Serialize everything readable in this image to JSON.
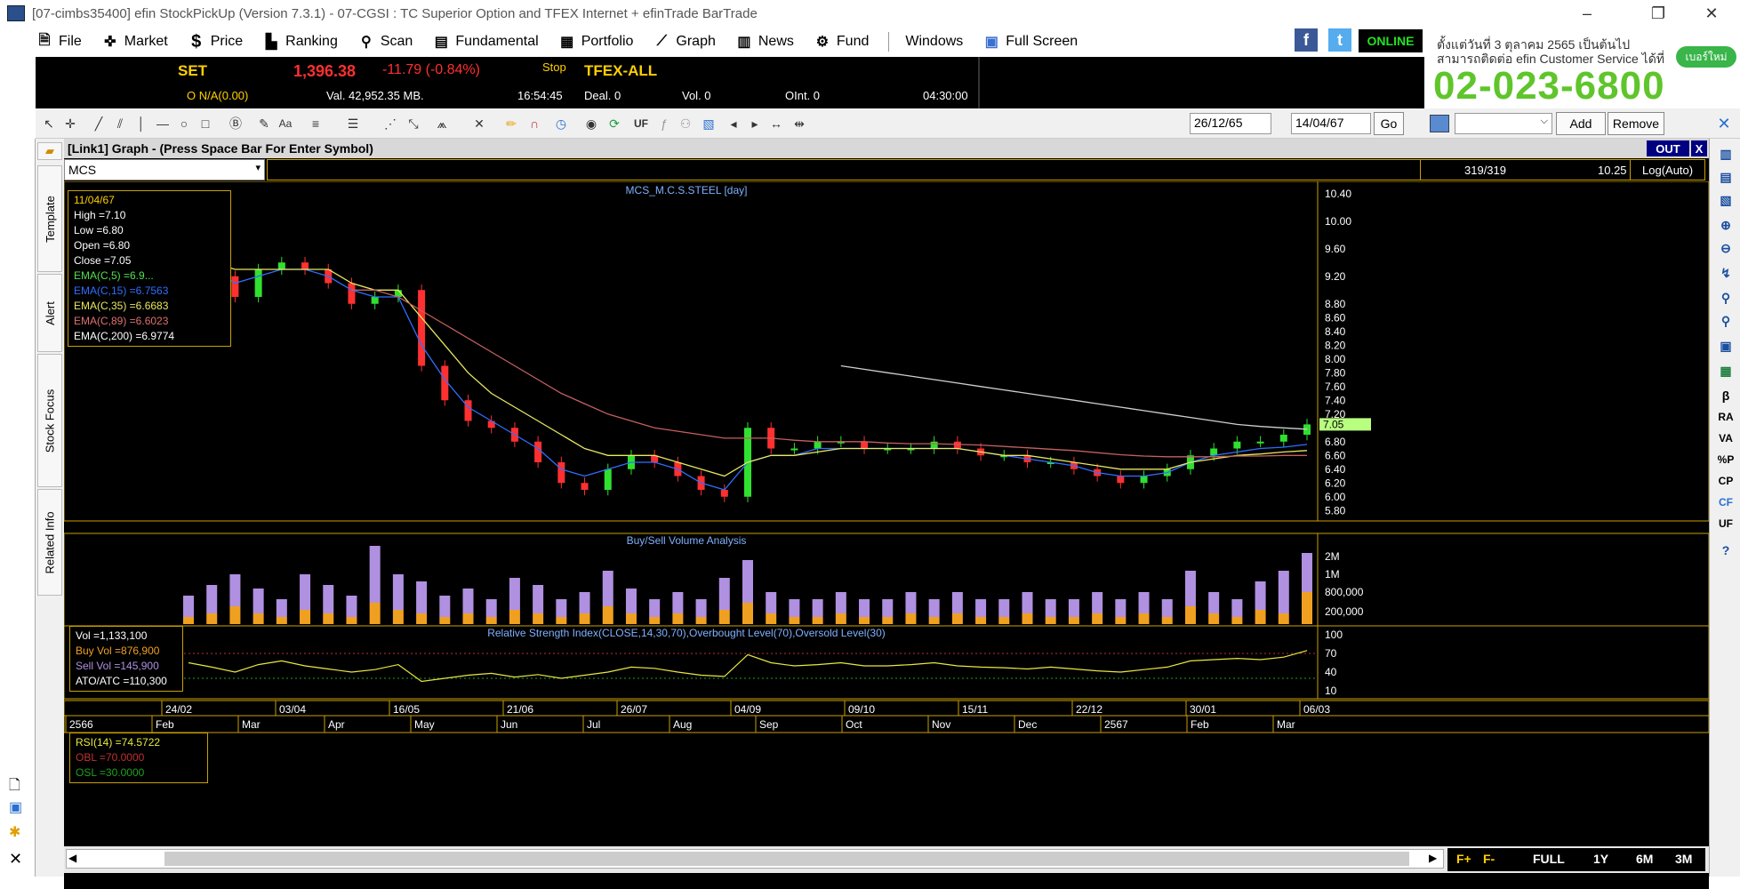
{
  "window": {
    "title": "[07-cimbs35400] efin StockPickUp (Version 7.3.1) - 07-CGSI : TC Superior Option and TFEX Internet + efinTrade BarTrade",
    "minimize": "–",
    "restore": "❐",
    "close": "✕"
  },
  "menu": [
    {
      "label": "File",
      "icon": "document-icon"
    },
    {
      "label": "Market",
      "icon": "market-icon"
    },
    {
      "label": "Price",
      "icon": "dollar-icon"
    },
    {
      "label": "Ranking",
      "icon": "ranking-icon"
    },
    {
      "label": "Scan",
      "icon": "scan-icon"
    },
    {
      "label": "Fundamental",
      "icon": "fundamental-icon"
    },
    {
      "label": "Portfolio",
      "icon": "portfolio-icon"
    },
    {
      "label": "Graph",
      "icon": "graph-icon"
    },
    {
      "label": "News",
      "icon": "news-icon"
    },
    {
      "label": "Fund",
      "icon": "fund-icon"
    },
    {
      "label": "Windows",
      "icon": ""
    },
    {
      "label": "Full Screen",
      "icon": "fullscreen-icon"
    }
  ],
  "status": {
    "online": "ONLINE"
  },
  "ad": {
    "line1": "ตั้งแต่วันที่ 3 ตุลาคม 2565 เป็นต้นไป",
    "line2": "สามารถติดต่อ efin Customer Service ได้ที่",
    "phone": "02-023-6800",
    "badge": "เบอร์ใหม่"
  },
  "ticker": {
    "set_label": "SET",
    "set_value": "1,396.38",
    "set_change": "-11.79 (-0.84%)",
    "set_sub": "O N/A(0.00)",
    "stop": "Stop",
    "value": "Val. 42,952.35 MB.",
    "time": "16:54:45",
    "tfex_label": "TFEX-ALL",
    "deal": "Deal. 0",
    "vol": "Vol. 0",
    "oint": "OInt. 0",
    "tfex_time": "04:30:00"
  },
  "toolbar": {
    "date_from": "26/12/65",
    "date_to": "14/04/67",
    "go": "Go",
    "add": "Add",
    "remove": "Remove",
    "uf": "UF",
    "aa": "Aa"
  },
  "graph": {
    "window_title": "[Link1] Graph  - (Press Space Bar For Enter Symbol)",
    "out": "OUT",
    "close": "X",
    "symbol": "MCS",
    "counter": "319/319",
    "last": "10.25",
    "scale": "Log(Auto)"
  },
  "side_tabs": [
    "Template",
    "Alert",
    "Stock Focus",
    "Related Info"
  ],
  "right_tools": [
    "β",
    "RA",
    "VA",
    "%P",
    "CP",
    "CF",
    "UF"
  ],
  "price_info": {
    "date": "11/04/67",
    "high": "High  =7.10",
    "low": "Low   =6.80",
    "open": "Open  =6.80",
    "close": "Close =7.05",
    "ema5": "EMA(C,5)   =6.9...",
    "ema15": "EMA(C,15)   =6.7563",
    "ema35": "EMA(C,35)   =6.6683",
    "ema89": "EMA(C,89)   =6.6023",
    "ema200": "EMA(C,200)  =6.9774"
  },
  "vol_info": {
    "vol": "Vol   =1,133,100",
    "buy": "Buy Vol   =876,900",
    "sell": "Sell Vol   =145,900",
    "ato": "ATO/ATC   =110,300"
  },
  "rsi_info": {
    "rsi": "RSI(14)   =74.5722",
    "obl": "OBL   =70.0000",
    "osl": "OSL   =30.0000"
  },
  "bottom_nav": {
    "f_plus": "F+",
    "f_minus": "F-",
    "full": "FULL",
    "y1": "1Y",
    "m6": "6M",
    "m3": "3M"
  },
  "chart_data": [
    {
      "type": "line",
      "title": "MCS_M.C.S.STEEL [day]",
      "ylim": [
        5.7,
        10.5
      ],
      "y_ticks": [
        "10.40",
        "10.00",
        "9.60",
        "9.20",
        "8.80",
        "8.60",
        "8.40",
        "8.20",
        "8.00",
        "7.80",
        "7.60",
        "7.40",
        "7.20",
        "6.80",
        "6.60",
        "6.40",
        "6.20",
        "6.00",
        "5.80"
      ],
      "last_label": "7.05",
      "x_top_ticks": [
        "24/02",
        "03/04",
        "16/05",
        "21/06",
        "26/07",
        "04/09",
        "09/10",
        "15/11",
        "22/12",
        "30/01",
        "06/03"
      ],
      "x_bottom_ticks": [
        "2566",
        "Feb",
        "Mar",
        "Apr",
        "May",
        "Jun",
        "Jul",
        "Aug",
        "Sep",
        "Oct",
        "Nov",
        "Dec",
        "2567",
        "Feb",
        "Mar"
      ],
      "series": [
        {
          "name": "Close",
          "color": "#ffffff",
          "values": [
            9.4,
            9.2,
            8.9,
            9.3,
            9.4,
            9.3,
            9.1,
            8.8,
            8.9,
            9.0,
            7.9,
            7.4,
            7.1,
            7.0,
            6.8,
            6.5,
            6.2,
            6.1,
            6.4,
            6.6,
            6.5,
            6.3,
            6.1,
            6.0,
            7.0,
            6.7,
            6.7,
            6.8,
            6.8,
            6.7,
            6.7,
            6.7,
            6.8,
            6.7,
            6.6,
            6.6,
            6.5,
            6.5,
            6.4,
            6.3,
            6.2,
            6.3,
            6.4,
            6.6,
            6.7,
            6.8,
            6.8,
            6.9,
            7.05
          ]
        },
        {
          "name": "EMA 15",
          "color": "#2f6fff",
          "values": [
            9.5,
            9.3,
            9.1,
            9.2,
            9.3,
            9.3,
            9.2,
            9.0,
            8.9,
            8.9,
            8.2,
            7.7,
            7.3,
            7.1,
            6.9,
            6.7,
            6.4,
            6.3,
            6.4,
            6.5,
            6.5,
            6.4,
            6.2,
            6.1,
            6.5,
            6.6,
            6.6,
            6.7,
            6.7,
            6.7,
            6.7,
            6.7,
            6.7,
            6.7,
            6.65,
            6.6,
            6.55,
            6.5,
            6.45,
            6.35,
            6.3,
            6.3,
            6.35,
            6.5,
            6.6,
            6.65,
            6.7,
            6.72,
            6.76
          ]
        },
        {
          "name": "EMA 35",
          "color": "#e8e860",
          "values": [
            9.6,
            9.4,
            9.3,
            9.3,
            9.3,
            9.3,
            9.3,
            9.1,
            9.0,
            9.0,
            8.6,
            8.2,
            7.8,
            7.5,
            7.3,
            7.1,
            6.9,
            6.7,
            6.6,
            6.6,
            6.6,
            6.5,
            6.4,
            6.3,
            6.5,
            6.6,
            6.6,
            6.65,
            6.7,
            6.7,
            6.7,
            6.7,
            6.7,
            6.7,
            6.65,
            6.6,
            6.6,
            6.55,
            6.5,
            6.45,
            6.4,
            6.4,
            6.4,
            6.5,
            6.55,
            6.6,
            6.62,
            6.65,
            6.67
          ]
        },
        {
          "name": "EMA 89",
          "color": "#c46060",
          "values": [
            null,
            null,
            null,
            null,
            null,
            null,
            null,
            9.0,
            9.0,
            8.9,
            8.7,
            8.5,
            8.3,
            8.1,
            7.9,
            7.7,
            7.5,
            7.35,
            7.2,
            7.1,
            7.0,
            6.95,
            6.9,
            6.85,
            6.85,
            6.85,
            6.82,
            6.8,
            6.8,
            6.8,
            6.78,
            6.77,
            6.77,
            6.76,
            6.75,
            6.73,
            6.71,
            6.69,
            6.67,
            6.64,
            6.61,
            6.59,
            6.58,
            6.58,
            6.58,
            6.59,
            6.59,
            6.6,
            6.6
          ]
        },
        {
          "name": "EMA 200",
          "color": "#d0d0d0",
          "values": [
            null,
            null,
            null,
            null,
            null,
            null,
            null,
            null,
            null,
            null,
            null,
            null,
            null,
            null,
            null,
            null,
            null,
            null,
            null,
            null,
            null,
            null,
            null,
            null,
            null,
            null,
            null,
            null,
            7.9,
            7.85,
            7.8,
            7.75,
            7.7,
            7.65,
            7.6,
            7.55,
            7.5,
            7.45,
            7.4,
            7.35,
            7.3,
            7.25,
            7.2,
            7.15,
            7.1,
            7.05,
            7.02,
            7.0,
            6.98
          ]
        }
      ]
    },
    {
      "type": "bar",
      "title": "Buy/Sell Volume Analysis",
      "y_ticks": [
        "2M",
        "1M",
        "800,000",
        "200,000"
      ],
      "series": [
        {
          "name": "Buy Vol",
          "color": "#f0a020",
          "values": [
            0.2,
            0.3,
            0.5,
            0.3,
            0.2,
            0.4,
            0.3,
            0.2,
            0.6,
            0.4,
            0.3,
            0.2,
            0.3,
            0.2,
            0.4,
            0.3,
            0.2,
            0.3,
            0.5,
            0.3,
            0.2,
            0.3,
            0.2,
            0.4,
            0.6,
            0.3,
            0.2,
            0.2,
            0.3,
            0.2,
            0.2,
            0.3,
            0.2,
            0.3,
            0.2,
            0.2,
            0.3,
            0.2,
            0.2,
            0.3,
            0.2,
            0.3,
            0.2,
            0.5,
            0.3,
            0.2,
            0.4,
            0.3,
            0.9
          ]
        },
        {
          "name": "Sell Vol",
          "color": "#b090e0",
          "values": [
            0.6,
            0.8,
            0.9,
            0.7,
            0.5,
            1.0,
            0.8,
            0.6,
            1.6,
            1.0,
            0.9,
            0.6,
            0.7,
            0.5,
            0.9,
            0.8,
            0.5,
            0.6,
            1.0,
            0.7,
            0.5,
            0.6,
            0.5,
            0.9,
            1.2,
            0.6,
            0.5,
            0.5,
            0.6,
            0.5,
            0.5,
            0.6,
            0.5,
            0.6,
            0.5,
            0.5,
            0.6,
            0.5,
            0.5,
            0.6,
            0.5,
            0.6,
            0.5,
            1.0,
            0.6,
            0.5,
            0.8,
            1.2,
            1.1
          ]
        }
      ]
    },
    {
      "type": "line",
      "title": "Relative Strength Index(CLOSE,14,30,70),Overbought Level(70),Oversold Level(30)",
      "ylim": [
        0,
        100
      ],
      "y_ticks": [
        "100",
        "70",
        "40",
        "10"
      ],
      "series": [
        {
          "name": "RSI(14)",
          "color": "#e8e840",
          "values": [
            55,
            48,
            40,
            52,
            58,
            50,
            45,
            40,
            44,
            52,
            25,
            30,
            35,
            38,
            32,
            36,
            30,
            35,
            40,
            48,
            46,
            40,
            35,
            33,
            68,
            55,
            50,
            52,
            55,
            50,
            50,
            52,
            55,
            50,
            48,
            47,
            45,
            48,
            45,
            42,
            40,
            44,
            48,
            58,
            60,
            62,
            60,
            64,
            74.57
          ]
        }
      ]
    }
  ]
}
